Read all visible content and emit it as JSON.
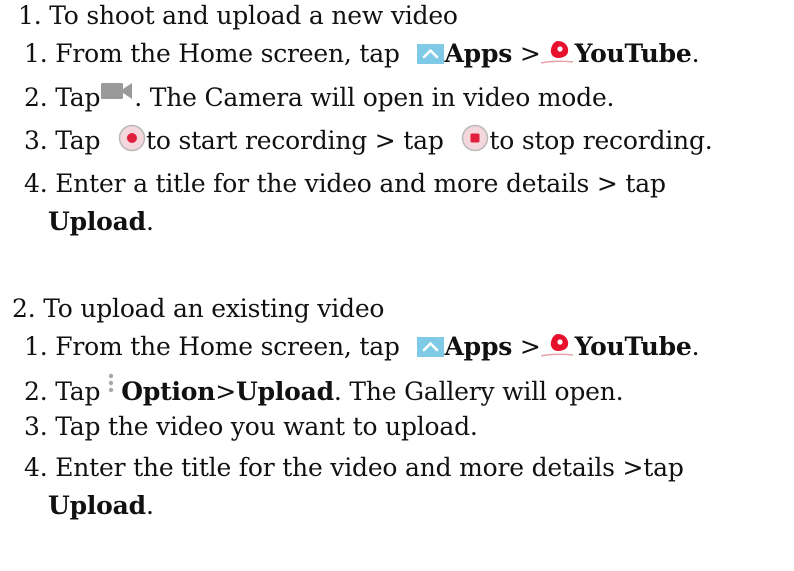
{
  "section1": {
    "heading": "1. To shoot and upload a new video",
    "steps": {
      "s1_prefix": "1. From the Home screen, tap ",
      "s1_apps": "Apps",
      "s1_sep": " >",
      "s1_youtube": "YouTube",
      "s1_end": ".",
      "s2_prefix": "2. Tap",
      "s2_rest": ". The Camera will open in video mode.",
      "s3_prefix": "3. Tap ",
      "s3_mid": "to start recording > tap ",
      "s3_end": "to stop recording.",
      "s4_line1": "4. Enter a title for the video and more details > tap",
      "s4_upload": "Upload",
      "s4_end": "."
    }
  },
  "section2": {
    "heading": "2. To upload an existing video",
    "steps": {
      "s1_prefix": "1. From the Home screen, tap ",
      "s1_apps": "Apps",
      "s1_sep": " >",
      "s1_youtube": "YouTube",
      "s1_end": ".",
      "s2_prefix": "2. Tap",
      "s2_option": "Option",
      "s2_gt": ">",
      "s2_upload": "Upload",
      "s2_rest": ". The Gallery will open.",
      "s3": "3. Tap the video you want to upload.",
      "s4_line1": "4. Enter the title for the video and more details >tap",
      "s4_upload": "Upload",
      "s4_end": "."
    }
  },
  "icons": {
    "apps": "apps-icon",
    "youtube": "youtube-icon",
    "camera": "video-camera-icon",
    "record_start": "record-start-icon",
    "record_stop": "record-stop-icon",
    "option": "overflow-menu-icon"
  },
  "colors": {
    "apps_blue": "#7fcbe7",
    "youtube_red": "#e8112d",
    "camera_gray": "#9a9a9a",
    "record_red": "#e0203a",
    "text": "#111111"
  }
}
